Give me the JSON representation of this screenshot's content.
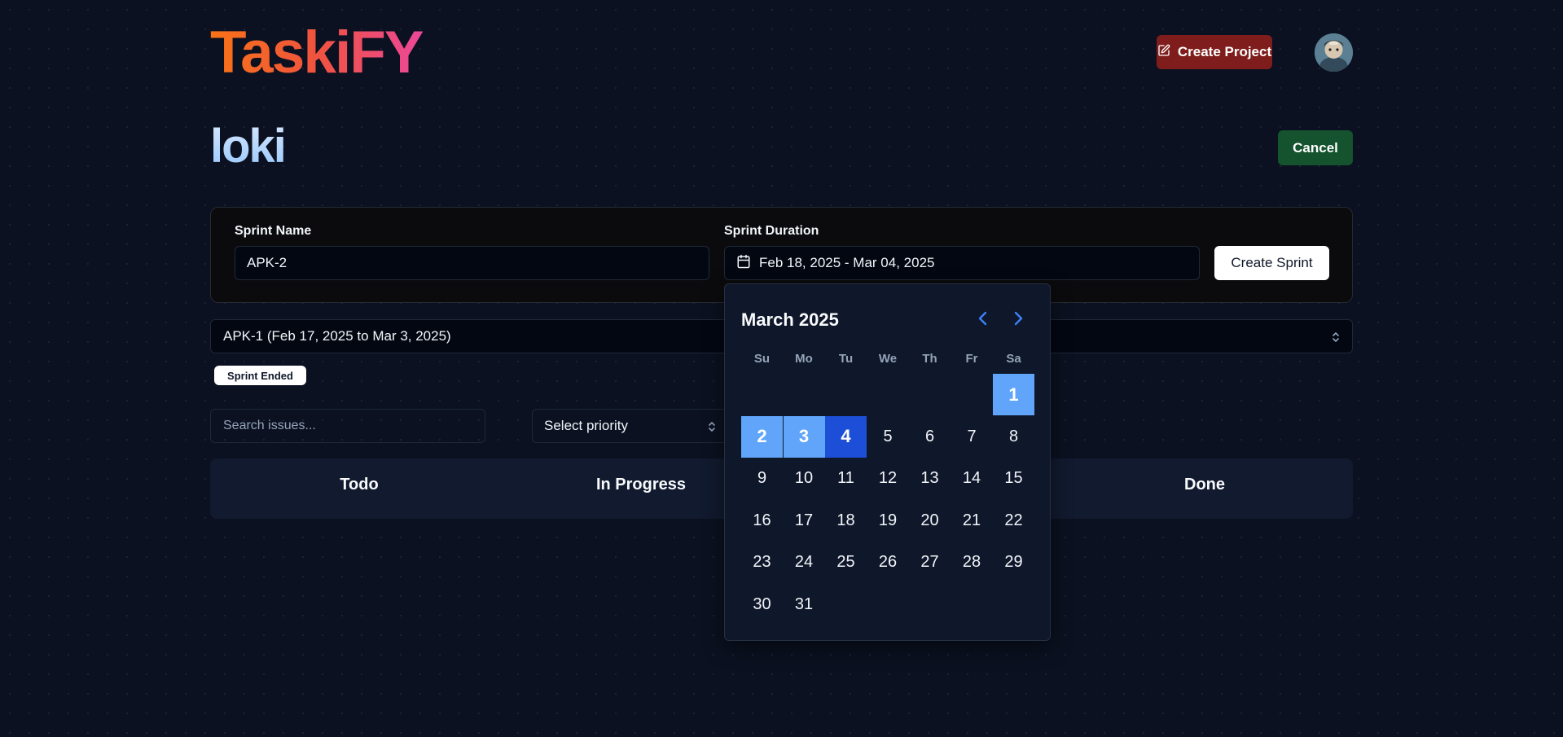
{
  "app": {
    "logo": "TaskiFY"
  },
  "header": {
    "create_project_label": "Create Project",
    "avatar_alt": "avatar"
  },
  "project": {
    "title": "loki",
    "cancel_label": "Cancel"
  },
  "sprint_form": {
    "name_label": "Sprint Name",
    "name_value": "APK-2",
    "duration_label": "Sprint Duration",
    "duration_value": "Feb 18, 2025 - Mar 04, 2025",
    "create_label": "Create Sprint"
  },
  "sprint_select": {
    "value": "APK-1 (Feb 17, 2025 to Mar 3, 2025)"
  },
  "status_badge": "Sprint Ended",
  "filters": {
    "search_placeholder": "Search issues...",
    "priority_value": "Select priority"
  },
  "board": {
    "columns": [
      "Todo",
      "In Progress",
      "Done"
    ]
  },
  "calendar": {
    "month_label": "March 2025",
    "weekdays": [
      "Su",
      "Mo",
      "Tu",
      "We",
      "Th",
      "Fr",
      "Sa"
    ],
    "first_weekday_index": 6,
    "days_in_month": 31,
    "selected_range_days": [
      1,
      2,
      3
    ],
    "range_end_day": 4
  },
  "colors": {
    "background": "#0b1120",
    "create_project": "#7f1d1d",
    "cancel": "#14532d",
    "range": "#60a5fa",
    "range_end": "#1d4ed8",
    "nav_arrow": "#3b82f6"
  }
}
